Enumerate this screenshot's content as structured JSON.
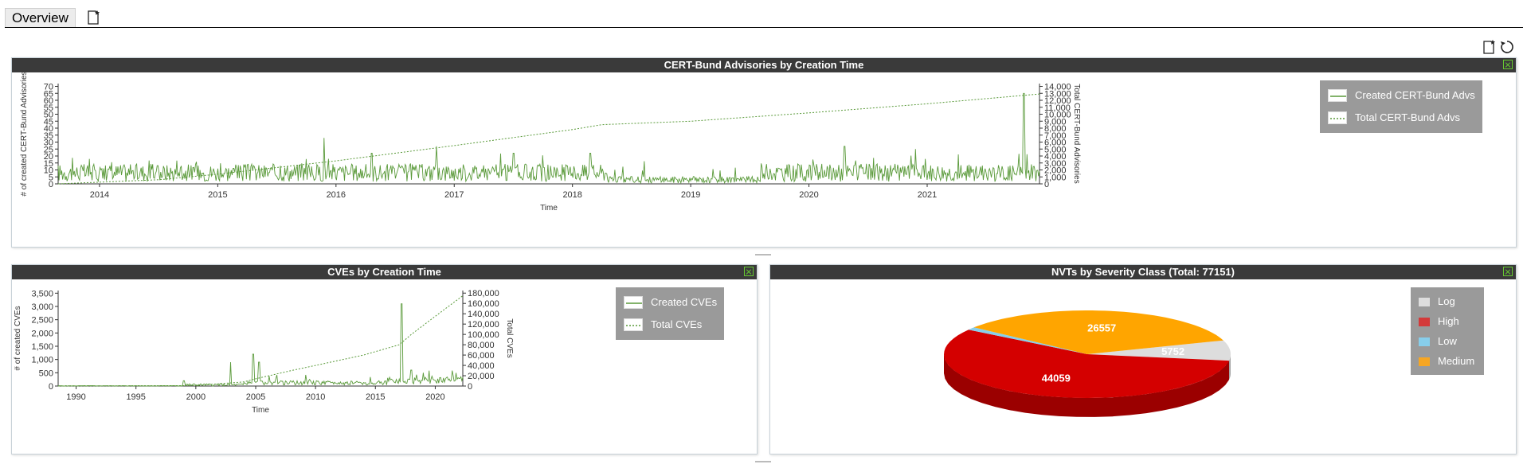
{
  "tabs": {
    "overview_label": "Overview",
    "add_icon": "add-dashboard-icon"
  },
  "toolbar": {
    "add_icon": "add-display-icon",
    "reset_icon": "reset-icon"
  },
  "panels": {
    "certbund": {
      "title": "CERT-Bund Advisories by Creation Time",
      "legend": [
        {
          "label": "Created CERT-Bund Advs",
          "style": "solid"
        },
        {
          "label": "Total CERT-Bund Advs",
          "style": "dotted"
        }
      ]
    },
    "cves": {
      "title": "CVEs by Creation Time",
      "legend": [
        {
          "label": "Created CVEs",
          "style": "solid"
        },
        {
          "label": "Total CVEs",
          "style": "dotted"
        }
      ]
    },
    "nvts": {
      "title": "NVTs by Severity Class (Total: 77151)",
      "legend": [
        {
          "label": "Log",
          "color": "#dddddd"
        },
        {
          "label": "High",
          "color": "#d43a3a"
        },
        {
          "label": "Low",
          "color": "#87ceeb"
        },
        {
          "label": "Medium",
          "color": "#f6a623"
        }
      ]
    }
  },
  "chart_data": [
    {
      "type": "line",
      "title": "CERT-Bund Advisories by Creation Time",
      "xlabel": "Time",
      "ylabel": "# of created CERT-Bund Advisories",
      "y2label": "Total CERT-Bund Advisories",
      "x_ticks": [
        "2014",
        "2015",
        "2016",
        "2017",
        "2018",
        "2019",
        "2020",
        "2021"
      ],
      "y_ticks": [
        "0",
        "5",
        "10",
        "15",
        "20",
        "25",
        "30",
        "35",
        "40",
        "45",
        "50",
        "55",
        "60",
        "65",
        "70"
      ],
      "y2_ticks": [
        "0",
        "1,000",
        "2,000",
        "3,000",
        "4,000",
        "5,000",
        "6,000",
        "7,000",
        "8,000",
        "9,000",
        "10,000",
        "11,000",
        "12,000",
        "13,000",
        "14,000"
      ],
      "xlim": [
        2013.65,
        2021.95
      ],
      "ylim": [
        0,
        72
      ],
      "y2lim": [
        0,
        14400
      ],
      "series": [
        {
          "name": "Created CERT-Bund Advs",
          "style": "solid",
          "color": "#5a9a3a",
          "baseline": 8,
          "spikes": [
            [
              2015.9,
              33
            ],
            [
              2016.3,
              22
            ],
            [
              2016.85,
              27
            ],
            [
              2017.5,
              22
            ],
            [
              2018.15,
              22
            ],
            [
              2020.3,
              27
            ],
            [
              2020.9,
              25
            ],
            [
              2021.82,
              65
            ]
          ]
        },
        {
          "name": "Total CERT-Bund Advs",
          "style": "dotted",
          "color": "#5a9a3a",
          "x": [
            2013.65,
            2014.5,
            2015,
            2016,
            2017,
            2018,
            2018.25,
            2019,
            2020,
            2021,
            2021.95
          ],
          "y": [
            0,
            600,
            1400,
            3300,
            5500,
            7800,
            8500,
            9000,
            10200,
            11500,
            12900
          ]
        }
      ]
    },
    {
      "type": "line",
      "title": "CVEs by Creation Time",
      "xlabel": "Time",
      "ylabel": "# of created CVEs",
      "y2label": "Total CVEs",
      "x_ticks": [
        "1990",
        "1995",
        "2000",
        "2005",
        "2010",
        "2015",
        "2020"
      ],
      "y_ticks": [
        "0",
        "500",
        "1,000",
        "1,500",
        "2,000",
        "2,500",
        "3,000",
        "3,500"
      ],
      "y2_ticks": [
        "0",
        "20,000",
        "40,000",
        "60,000",
        "80,000",
        "100,000",
        "120,000",
        "140,000",
        "160,000",
        "180,000"
      ],
      "xlim": [
        1988.5,
        2022.3
      ],
      "ylim": [
        0,
        3600
      ],
      "y2lim": [
        0,
        185000
      ],
      "series": [
        {
          "name": "Created CVEs",
          "style": "solid",
          "color": "#5a9a3a",
          "spikes": [
            [
              1999,
              200
            ],
            [
              2002.9,
              900
            ],
            [
              2004.8,
              1200
            ],
            [
              2005.3,
              900
            ],
            [
              2017.2,
              3100
            ],
            [
              2018,
              600
            ],
            [
              2019,
              500
            ],
            [
              2021.5,
              400
            ]
          ]
        },
        {
          "name": "Total CVEs",
          "style": "dotted",
          "color": "#5a9a3a",
          "x": [
            1988.5,
            2000,
            2004,
            2005,
            2008,
            2010,
            2014,
            2017,
            2018,
            2020,
            2022.3
          ],
          "y": [
            0,
            1000,
            8000,
            14000,
            30000,
            40000,
            60000,
            80000,
            100000,
            135000,
            175000
          ]
        }
      ]
    },
    {
      "type": "pie",
      "title": "NVTs by Severity Class (Total: 77151)",
      "total": 77151,
      "slices": [
        {
          "label": "Log",
          "value": 5752,
          "color": "#dddddd",
          "side_color": "#a8a8a8"
        },
        {
          "label": "High",
          "value": 44059,
          "color": "#d40000",
          "side_color": "#9b0000"
        },
        {
          "label": "Low",
          "value": 783,
          "color": "#87ceeb",
          "side_color": "#5a9aab"
        },
        {
          "label": "Medium",
          "value": 26557,
          "color": "#ffa500",
          "side_color": "#c27e00"
        }
      ],
      "data_labels": [
        "5752",
        "44059",
        "26557"
      ]
    }
  ]
}
